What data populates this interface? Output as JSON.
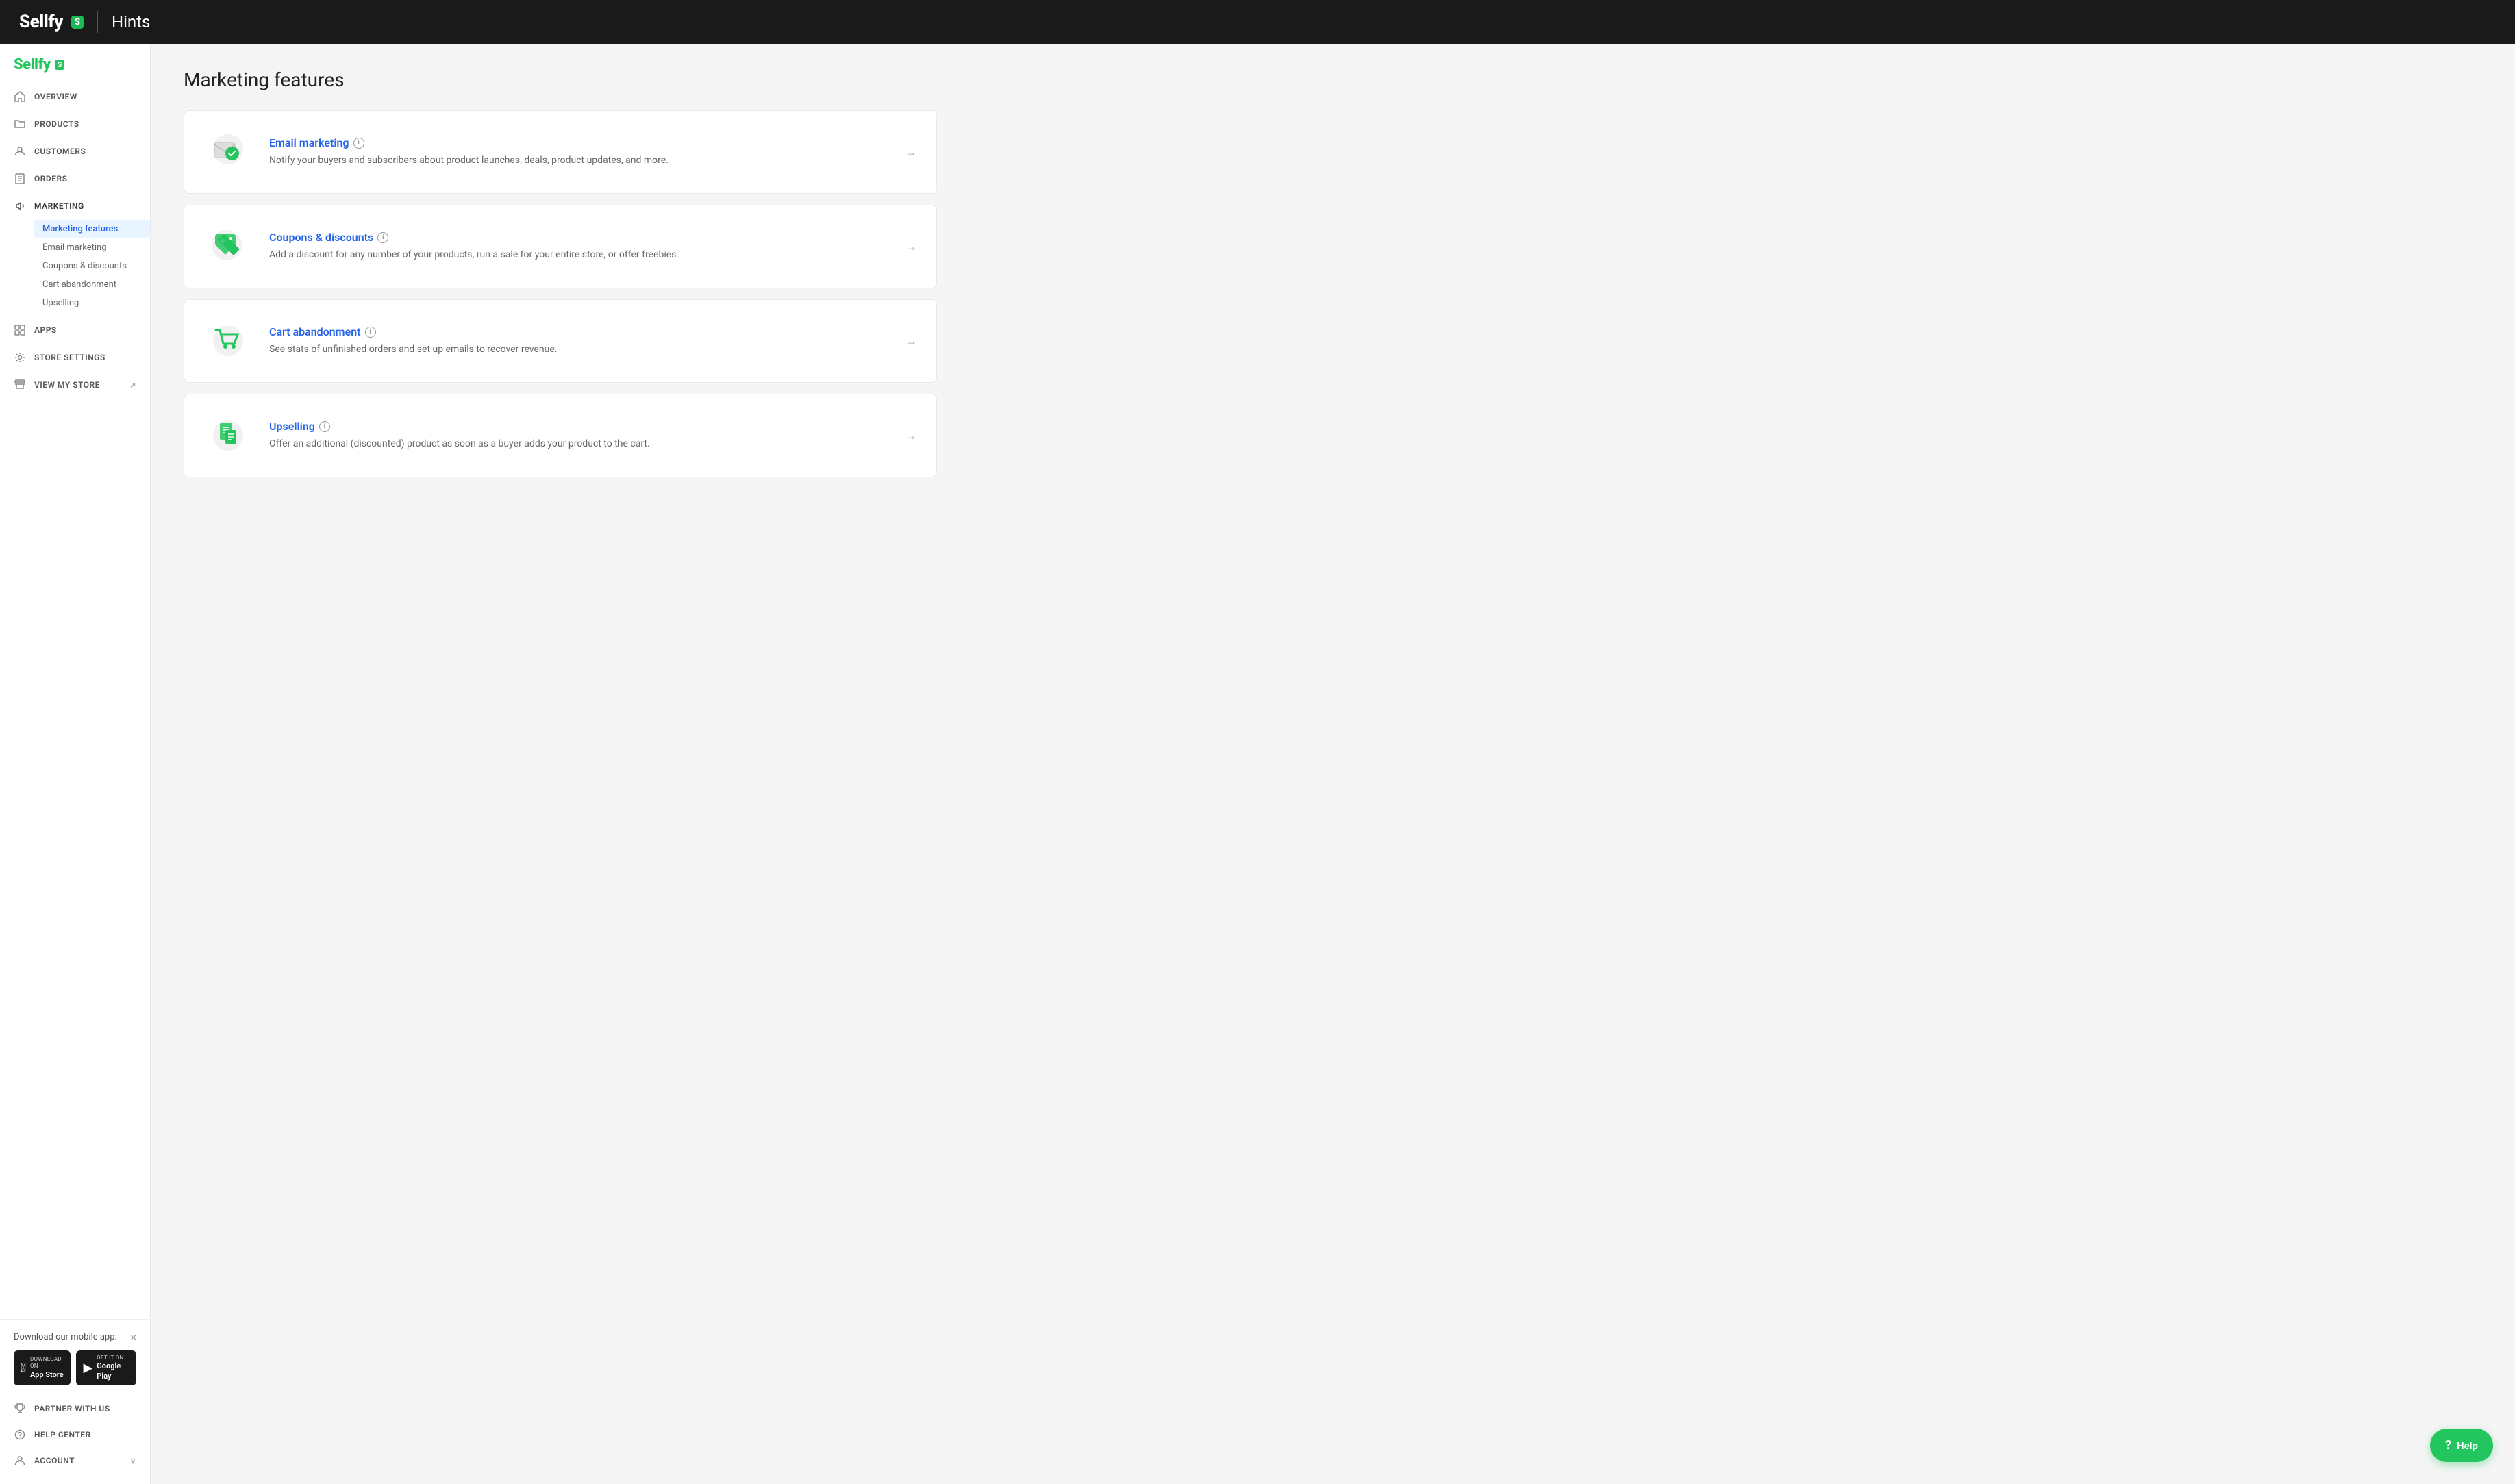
{
  "header": {
    "logo_text": "Sellfy",
    "logo_badge": "S",
    "divider": true,
    "page_title": "Hints"
  },
  "sidebar": {
    "brand_text": "Sellfy",
    "brand_badge": "S",
    "nav_items": [
      {
        "id": "overview",
        "label": "Overview",
        "icon": "home"
      },
      {
        "id": "products",
        "label": "Products",
        "icon": "folder"
      },
      {
        "id": "customers",
        "label": "Customers",
        "icon": "person"
      },
      {
        "id": "orders",
        "label": "Orders",
        "icon": "receipt"
      },
      {
        "id": "marketing",
        "label": "Marketing",
        "icon": "megaphone",
        "active": true
      }
    ],
    "sub_nav": [
      {
        "id": "marketing-features",
        "label": "Marketing features",
        "active": true
      },
      {
        "id": "email-marketing",
        "label": "Email marketing"
      },
      {
        "id": "coupons-discounts",
        "label": "Coupons & discounts"
      },
      {
        "id": "cart-abandonment",
        "label": "Cart abandonment"
      },
      {
        "id": "upselling",
        "label": "Upselling"
      }
    ],
    "footer_nav": [
      {
        "id": "apps",
        "label": "Apps",
        "icon": "grid"
      },
      {
        "id": "store-settings",
        "label": "Store Settings",
        "icon": "gear"
      },
      {
        "id": "view-my-store",
        "label": "View My Store",
        "icon": "external"
      }
    ],
    "mobile_app": {
      "label": "Download our mobile app:",
      "close_btn": "×",
      "app_store_label": "Download on",
      "app_store_name": "App Store",
      "play_store_label": "GET IT ON",
      "play_store_name": "Google Play"
    },
    "partner": {
      "id": "partner",
      "label": "Partner With Us",
      "icon": "trophy"
    },
    "help_center": {
      "id": "help-center",
      "label": "Help Center",
      "icon": "person"
    },
    "account": {
      "id": "account",
      "label": "Account",
      "icon": "person"
    }
  },
  "main": {
    "page_heading": "Marketing features",
    "feature_cards": [
      {
        "id": "email-marketing",
        "title": "Email marketing",
        "description": "Notify your buyers and subscribers about product launches, deals, product updates, and more.",
        "icon_type": "email"
      },
      {
        "id": "coupons-discounts",
        "title": "Coupons & discounts",
        "description": "Add a discount for any number of your products, run a sale for your entire store, or offer freebies.",
        "icon_type": "coupon"
      },
      {
        "id": "cart-abandonment",
        "title": "Cart abandonment",
        "description": "See stats of unfinished orders and set up emails to recover revenue.",
        "icon_type": "cart"
      },
      {
        "id": "upselling",
        "title": "Upselling",
        "description": "Offer an additional (discounted) product as soon as a buyer adds your product to the cart.",
        "icon_type": "upsell"
      }
    ]
  },
  "help_button": {
    "label": "Help",
    "icon": "?"
  },
  "colors": {
    "brand_green": "#22c55e",
    "link_blue": "#2563eb",
    "header_bg": "#1a1a1a"
  }
}
